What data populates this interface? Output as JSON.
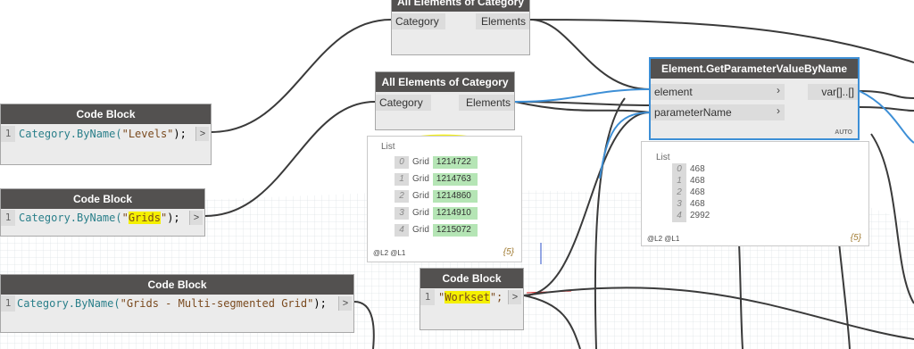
{
  "nodes": {
    "top_category": {
      "title": "All Elements of Category",
      "in_port": "Category",
      "out_port": "Elements"
    },
    "mid_category": {
      "title": "All Elements of Category",
      "in_port": "Category",
      "out_port": "Elements"
    },
    "getparam": {
      "title": "Element.GetParameterValueByName",
      "in_port_1": "element",
      "in_port_2": "parameterName",
      "out_port": "var[]..[]",
      "mode": "AUTO"
    },
    "cb_levels": {
      "title": "Code Block",
      "line_num": "1",
      "code_func": "Category.ByName(",
      "code_str": "\"Levels\"",
      "code_end": ");",
      "out_arrow": ">"
    },
    "cb_grids": {
      "title": "Code Block",
      "line_num": "1",
      "code_func": "Category.ByName(",
      "code_q1": "\"",
      "code_hl": "Grids",
      "code_q2": "\"",
      "code_end": ");",
      "out_arrow": ">"
    },
    "cb_multi": {
      "title": "Code Block",
      "line_num": "1",
      "code_func": "Category.ByName(",
      "code_str": "\"Grids - Multi-segmented Grid\"",
      "code_end": ");",
      "out_arrow": ">"
    },
    "cb_workset": {
      "title": "Code Block",
      "line_num": "1",
      "code_q1": "\"",
      "code_hl": "Workset",
      "code_q2": "\";",
      "out_arrow": ">"
    }
  },
  "preview_grids": {
    "title": "List",
    "rows": [
      {
        "idx": "0",
        "label": "Grid",
        "value": "1214722"
      },
      {
        "idx": "1",
        "label": "Grid",
        "value": "1214763"
      },
      {
        "idx": "2",
        "label": "Grid",
        "value": "1214860"
      },
      {
        "idx": "3",
        "label": "Grid",
        "value": "1214910"
      },
      {
        "idx": "4",
        "label": "Grid",
        "value": "1215072"
      }
    ],
    "levels": "@L2 @L1",
    "count": "{5}"
  },
  "preview_values": {
    "title": "List",
    "rows": [
      {
        "idx": "0",
        "value": "468"
      },
      {
        "idx": "1",
        "value": "468"
      },
      {
        "idx": "2",
        "value": "468"
      },
      {
        "idx": "3",
        "value": "468"
      },
      {
        "idx": "4",
        "value": "2992"
      }
    ],
    "levels": "@L2 @L1",
    "count": "{5}"
  },
  "colors": {
    "header": "#535150",
    "node_body": "#ebebeb",
    "wire": "#3a3a3a",
    "wire_selected": "#3d8fd6",
    "highlight": "#f4f000",
    "list_value": "#b5e5b5"
  }
}
